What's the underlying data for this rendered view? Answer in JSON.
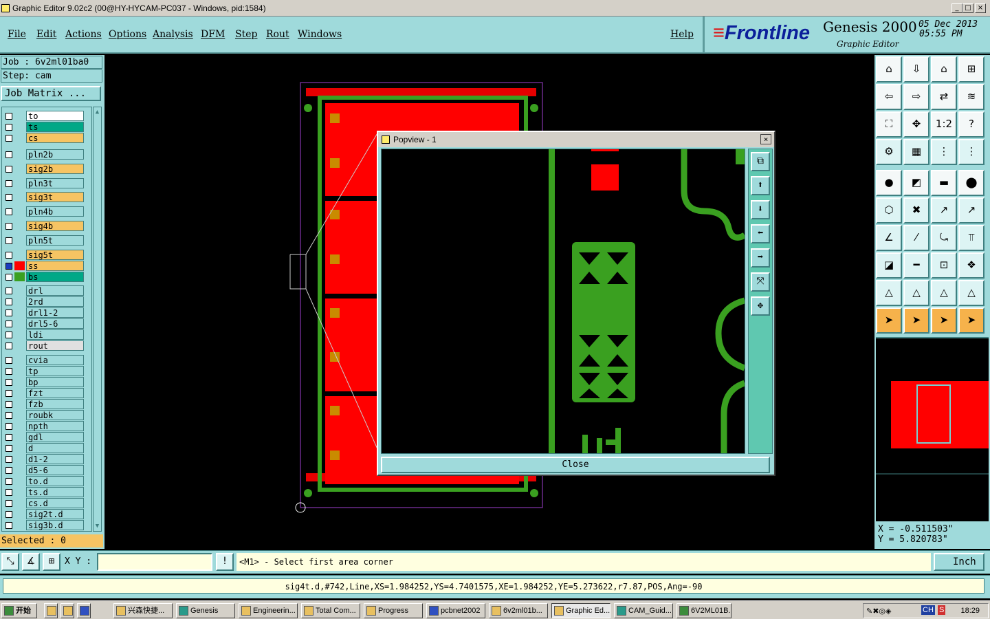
{
  "window": {
    "title": "Graphic Editor 9.02c2 (00@HY-HYCAM-PC037 - Windows, pid:1584)"
  },
  "menu": [
    "File",
    "Edit",
    "Actions",
    "Options",
    "Analysis",
    "DFM",
    "Step",
    "Rout",
    "Windows"
  ],
  "help": "Help",
  "logo": {
    "brand": "Frontline",
    "product": "Genesis 2000",
    "subtitle": "Graphic Editor",
    "date": "05 Dec 2013",
    "time": "05:55 PM"
  },
  "job": {
    "job_label": "Job : 6v2ml01ba0",
    "step_label": "Step: cam",
    "matrix_button": "Job Matrix ..."
  },
  "layers": [
    {
      "name": "to",
      "color": "#ffffff",
      "active": false
    },
    {
      "name": "ts",
      "color": "#00a887",
      "active": false
    },
    {
      "name": "cs",
      "color": "#f6c463",
      "active": false
    },
    {
      "name": "pln2b",
      "color": "#9fdadb",
      "active": false
    },
    {
      "name": "sig2b",
      "color": "#f6c463",
      "active": false
    },
    {
      "name": "pln3t",
      "color": "#9fdadb",
      "active": false
    },
    {
      "name": "sig3t",
      "color": "#f6c463",
      "active": false
    },
    {
      "name": "pln4b",
      "color": "#9fdadb",
      "active": false
    },
    {
      "name": "sig4b",
      "color": "#f6c463",
      "active": false
    },
    {
      "name": "pln5t",
      "color": "#9fdadb",
      "active": false
    },
    {
      "name": "sig5t",
      "color": "#f6c463",
      "active": false
    },
    {
      "name": "ss",
      "color": "#f6c463",
      "active": true,
      "swatch": "#ff0000"
    },
    {
      "name": "bs",
      "color": "#00a887",
      "active": false,
      "swatch": "#3aa020"
    },
    {
      "name": "drl",
      "color": "#9fdadb",
      "active": false
    },
    {
      "name": "2rd",
      "color": "#9fdadb",
      "active": false
    },
    {
      "name": "drl1-2",
      "color": "#9fdadb",
      "active": false
    },
    {
      "name": "drl5-6",
      "color": "#9fdadb",
      "active": false
    },
    {
      "name": "ldi",
      "color": "#9fdadb",
      "active": false
    },
    {
      "name": "rout",
      "color": "#e0e0e0",
      "active": false
    },
    {
      "name": "cvia",
      "color": "#9fdadb",
      "active": false
    },
    {
      "name": "tp",
      "color": "#9fdadb",
      "active": false
    },
    {
      "name": "bp",
      "color": "#9fdadb",
      "active": false
    },
    {
      "name": "fzt",
      "color": "#9fdadb",
      "active": false
    },
    {
      "name": "fzb",
      "color": "#9fdadb",
      "active": false
    },
    {
      "name": "roubk",
      "color": "#9fdadb",
      "active": false
    },
    {
      "name": "npth",
      "color": "#9fdadb",
      "active": false
    },
    {
      "name": "gdl",
      "color": "#9fdadb",
      "active": false
    },
    {
      "name": "d",
      "color": "#9fdadb",
      "active": false
    },
    {
      "name": "d1-2",
      "color": "#9fdadb",
      "active": false
    },
    {
      "name": "d5-6",
      "color": "#9fdadb",
      "active": false
    },
    {
      "name": "to.d",
      "color": "#9fdadb",
      "active": false
    },
    {
      "name": "ts.d",
      "color": "#9fdadb",
      "active": false
    },
    {
      "name": "cs.d",
      "color": "#9fdadb",
      "active": false
    },
    {
      "name": "sig2t.d",
      "color": "#9fdadb",
      "active": false
    },
    {
      "name": "sig3b.d",
      "color": "#9fdadb",
      "active": false
    }
  ],
  "selected": "Selected : 0",
  "popview": {
    "title": "Popview - 1",
    "close_button": "Close"
  },
  "coords": {
    "x": "X = -0.511503\"",
    "y": "Y = 5.820783\""
  },
  "bottom": {
    "xy_label": "X Y :",
    "xy_value": "",
    "prompt": "<M1> - Select first area corner",
    "units": "Inch"
  },
  "status": "sig4t.d,#742,Line,XS=1.984252,YS=4.7401575,XE=1.984252,YE=5.273622,r7.87,POS,Ang=-90",
  "taskbar": {
    "start": "开始",
    "items": [
      "兴森快捷...",
      "Genesis",
      "Engineerin...",
      "Total Com...",
      "Progress",
      "pcbnet2002",
      "6v2ml01b...",
      "Graphic Ed...",
      "CAM_Guid...",
      "6V2ML01B..."
    ],
    "tray_lang": "CH",
    "clock": "18:29"
  }
}
